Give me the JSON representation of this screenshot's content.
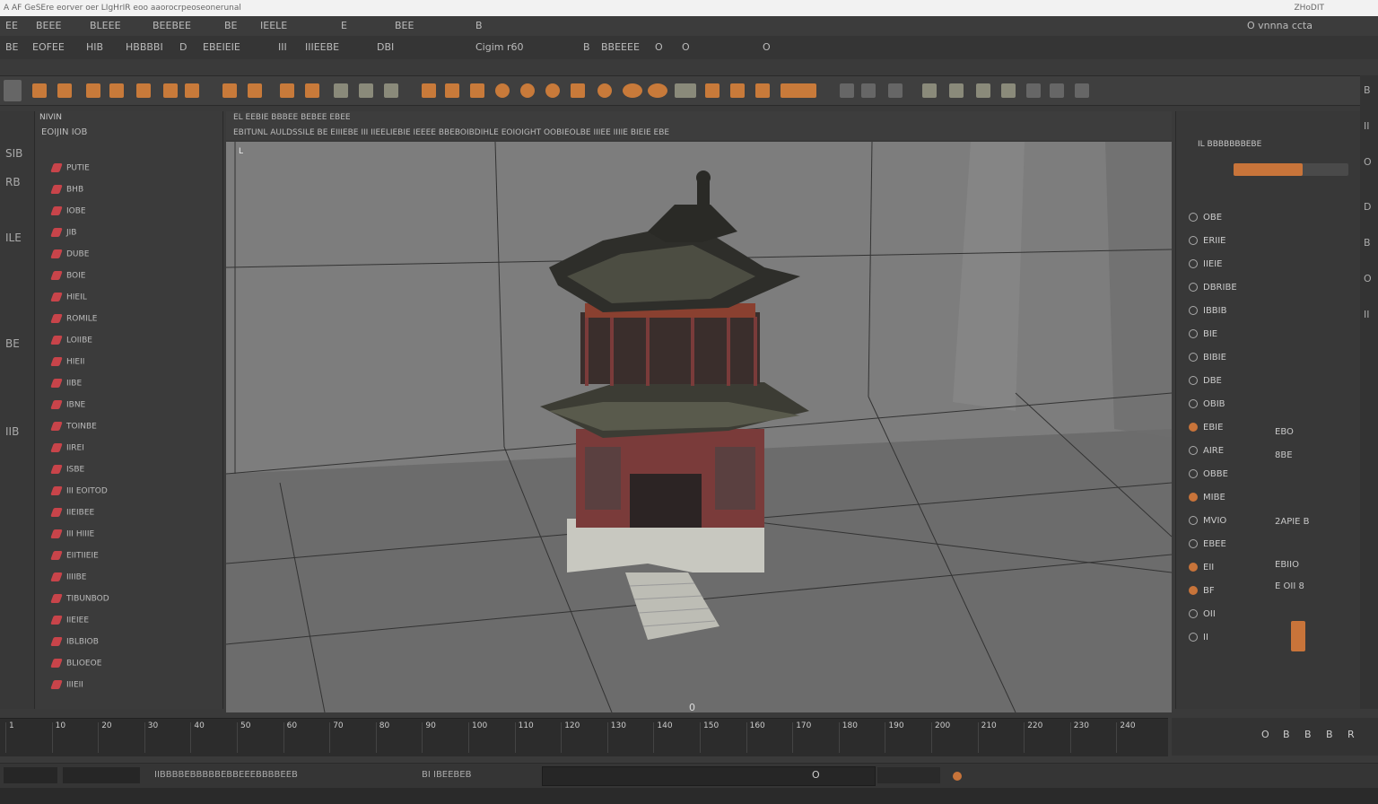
{
  "title_bar": {
    "text": "A AF GeSEre eorver oer LIgHrIR eoo aaorocrpeoseonerunal",
    "right_text": "ZHoDIT"
  },
  "menu_bar": {
    "items": [
      "EE",
      "BEEE",
      "BLEEE",
      "BEEBEE",
      "BE",
      "IEELE",
      "E",
      "BEE",
      "B"
    ],
    "right_label": "O vnnna ccta"
  },
  "menu_bar2": {
    "items": [
      "BE",
      "EOFEE",
      "HIB",
      "HBBBBI",
      "D",
      "EBEIEIE",
      "III",
      "IIIEEBE",
      "DBI",
      "Cigim r60",
      "B",
      "BBEEEE",
      "O",
      "O",
      "O"
    ]
  },
  "shelf": {
    "tools": [
      "move-tool",
      "rotate-tool",
      "scale-tool",
      "select-tool",
      "lasso-tool",
      "paint-tool",
      "snap-grid",
      "snap-curve",
      "snap-point",
      "render-tool",
      "camera-tool",
      "light-tool"
    ]
  },
  "outliner": {
    "header": "NIVIN",
    "tab": "EOIJIN  IOB",
    "items": [
      "PUTIE",
      "BHB",
      "IOBE",
      "JIB",
      "DUBE",
      "BOIE",
      "HIEIL",
      "ROMILE",
      "LOIIBE",
      "HIEII",
      "IIBE",
      "IBNE",
      "TOINBE",
      "IIREI",
      "ISBE",
      "III EOITOD",
      "IIEIBEE",
      "III HIIIE",
      "EIITIIEIE",
      "IIIIBE",
      "TIBUNBOD",
      "IIEIEE",
      "IBLBIOB",
      "BLIOEOE",
      "IIIEII"
    ]
  },
  "left_strip": {
    "labels": [
      "SIB",
      "RB",
      "ILE",
      "BE",
      "IIB"
    ]
  },
  "viewport": {
    "header_line1": "EL  EEBIE  BBBEE  BEBEE  EBEE",
    "header_line2": "EBITUNL  AULDSSILE  BE  EIIIEBE  III  IIEELIEBIE  IEEEE  BBEBOIBDIHLE  EOIOIGHT  OOBIEOLBE  IIIEE  IIIIE  BIEIE  EBE",
    "hud": "L",
    "frame_marker": "0"
  },
  "right_panel": {
    "header": "IL  BBBBBBBEBE",
    "rows": [
      {
        "label": "OBE",
        "on": false
      },
      {
        "label": "ERIIE",
        "on": false
      },
      {
        "label": "IIEIE",
        "on": false
      },
      {
        "label": "DBRIBE",
        "on": false
      },
      {
        "label": "IBBIB",
        "on": false
      },
      {
        "label": "BIE",
        "on": false
      },
      {
        "label": "BIBIE",
        "on": false
      },
      {
        "label": "DBE",
        "on": false
      },
      {
        "label": "OBIB",
        "on": false
      },
      {
        "label": "EBIE",
        "on": true
      },
      {
        "label": "AIRE",
        "on": false
      },
      {
        "label": "OBBE",
        "on": false
      },
      {
        "label": "MIBE",
        "on": true
      },
      {
        "label": "MVIO",
        "on": false
      },
      {
        "label": "EBEE",
        "on": false
      },
      {
        "label": "EII",
        "on": true
      },
      {
        "label": "BF",
        "on": true
      },
      {
        "label": "OII",
        "on": false
      },
      {
        "label": "II",
        "on": false
      }
    ],
    "value_labels": [
      "EBO",
      "8BE",
      "2APIE B",
      "EBIIO",
      "E OII 8"
    ],
    "slider_value": 0.6
  },
  "right_strip": {
    "labels": [
      "B",
      "II",
      "O",
      "D",
      "B",
      "O",
      "II"
    ]
  },
  "timeline": {
    "labels": [
      "1",
      "10",
      "20",
      "30",
      "40",
      "50",
      "60",
      "70",
      "80",
      "90",
      "100",
      "110",
      "120",
      "130",
      "140",
      "150",
      "160",
      "170",
      "180",
      "190",
      "200",
      "210",
      "220",
      "230",
      "240"
    ],
    "controls": [
      "O",
      "B",
      "B",
      "B",
      "R"
    ]
  },
  "status_bar": {
    "left_text": "IIBBBBEBBBBBEBBEEEBBBBEEB",
    "mid_text": "BI IBEEBEB",
    "cmd_value": "",
    "cmd_marker": "O"
  },
  "colors": {
    "accent": "#c8743a",
    "outliner_icon": "#c8444a",
    "background": "#3a3a3a",
    "viewport": "#777777"
  }
}
